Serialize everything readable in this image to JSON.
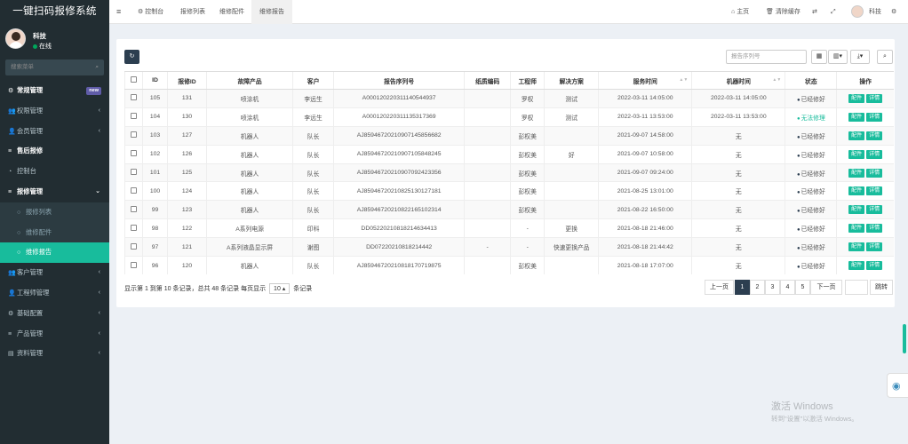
{
  "app_title": "一键扫码报修系统",
  "user": {
    "name": "科技",
    "status": "在线"
  },
  "search_placeholder": "搜索菜单",
  "menu": [
    {
      "label": "常规管理",
      "icon": "gear-icon",
      "badge": "new",
      "type": "head"
    },
    {
      "label": "权限管理",
      "icon": "users-icon",
      "type": "item"
    },
    {
      "label": "会员管理",
      "icon": "user-icon",
      "type": "item"
    },
    {
      "label": "售后报修",
      "icon": "list-icon",
      "type": "head"
    },
    {
      "label": "控制台",
      "icon": "dashboard-icon",
      "type": "item"
    },
    {
      "label": "报修管理",
      "icon": "list-icon",
      "type": "head-open"
    },
    {
      "label": "报修列表",
      "icon": "circle-icon",
      "type": "sub"
    },
    {
      "label": "维修配件",
      "icon": "circle-icon",
      "type": "sub"
    },
    {
      "label": "维修报告",
      "icon": "circle-icon",
      "type": "active"
    },
    {
      "label": "客户管理",
      "icon": "users-icon",
      "type": "item"
    },
    {
      "label": "工程师管理",
      "icon": "user-icon",
      "type": "item"
    },
    {
      "label": "基础配置",
      "icon": "gear-icon",
      "type": "item"
    },
    {
      "label": "产品管理",
      "icon": "list-icon",
      "type": "item"
    },
    {
      "label": "资料管理",
      "icon": "file-icon",
      "type": "item"
    }
  ],
  "topbar": {
    "tabs": [
      "控制台",
      "报修列表",
      "维修配件",
      "维修报告"
    ],
    "home": "主页",
    "clear_cache": "清除缓存",
    "user": "科技"
  },
  "toolbar": {
    "search_placeholder": "报告序列号"
  },
  "table": {
    "headers": [
      "ID",
      "报修ID",
      "故障产品",
      "客户",
      "报告序列号",
      "纸质编码",
      "工程师",
      "解决方案",
      "服务时间",
      "机器时间",
      "状态",
      "操作"
    ],
    "rows": [
      {
        "id": "105",
        "rid": "131",
        "product": "喷涂机",
        "customer": "李远生",
        "serial": "A00012022031114054493​7",
        "paper": "",
        "engineer": "罗权",
        "solution": "测试",
        "service_time": "2022-03-11 14:05:00",
        "machine_time": "2022-03-11 14:05:00",
        "status": "已经修好",
        "ok": true
      },
      {
        "id": "104",
        "rid": "130",
        "product": "喷涂机",
        "customer": "李远生",
        "serial": "A000120220311135317369",
        "paper": "",
        "engineer": "罗权",
        "solution": "测试",
        "service_time": "2022-03-11 13:53:00",
        "machine_time": "2022-03-11 13:53:00",
        "status": "无法修理",
        "ok": false
      },
      {
        "id": "103",
        "rid": "127",
        "product": "机器人",
        "customer": "队长",
        "serial": "AJ85946720210907145856682",
        "paper": "",
        "engineer": "彭权美",
        "solution": "",
        "service_time": "2021-09-07 14:58:00",
        "machine_time": "无",
        "status": "已经修好",
        "ok": true
      },
      {
        "id": "102",
        "rid": "126",
        "product": "机器人",
        "customer": "队长",
        "serial": "AJ85946720210907105848245",
        "paper": "",
        "engineer": "彭权美",
        "solution": "好",
        "service_time": "2021-09-07 10:58:00",
        "machine_time": "无",
        "status": "已经修好",
        "ok": true
      },
      {
        "id": "101",
        "rid": "125",
        "product": "机器人",
        "customer": "队长",
        "serial": "AJ85946720210907092423356",
        "paper": "",
        "engineer": "彭权美",
        "solution": "",
        "service_time": "2021-09-07 09:24:00",
        "machine_time": "无",
        "status": "已经修好",
        "ok": true
      },
      {
        "id": "100",
        "rid": "124",
        "product": "机器人",
        "customer": "队长",
        "serial": "AJ85946720210825130127181",
        "paper": "",
        "engineer": "彭权美",
        "solution": "",
        "service_time": "2021-08-25 13:01:00",
        "machine_time": "无",
        "status": "已经修好",
        "ok": true
      },
      {
        "id": "99",
        "rid": "123",
        "product": "机器人",
        "customer": "队长",
        "serial": "AJ85946720210822165102314",
        "paper": "",
        "engineer": "彭权美",
        "solution": "",
        "service_time": "2021-08-22 16:50:00",
        "machine_time": "无",
        "status": "已经修好",
        "ok": true
      },
      {
        "id": "98",
        "rid": "122",
        "product": "A系列电源",
        "customer": "印科",
        "serial": "DD05220210818214634413",
        "paper": "",
        "engineer": "-",
        "solution": "更换",
        "service_time": "2021-08-18 21:46:00",
        "machine_time": "无",
        "status": "已经修好",
        "ok": true
      },
      {
        "id": "97",
        "rid": "121",
        "product": "A系列液晶显示屏",
        "customer": "谢图",
        "serial": "DD07220210818214442",
        "paper": "-",
        "engineer": "-",
        "solution": "快速更换产品",
        "service_time": "2021-08-18 21:44:42",
        "machine_time": "无",
        "status": "已经修好",
        "ok": true
      },
      {
        "id": "96",
        "rid": "120",
        "product": "机器人",
        "customer": "队长",
        "serial": "AJ85946720210818170719875",
        "paper": "",
        "engineer": "彭权美",
        "solution": "",
        "service_time": "2021-08-18 17:07:00",
        "machine_time": "无",
        "status": "已经修好",
        "ok": true
      }
    ],
    "op_parts": "配件",
    "op_detail": "详情"
  },
  "pager": {
    "info_prefix": "显示第 1 到第 10 条记录，总共 48 条记录 每页显示",
    "page_size": "10",
    "info_suffix": "条记录",
    "prev": "上一页",
    "pages": [
      "1",
      "2",
      "3",
      "4",
      "5"
    ],
    "next": "下一页",
    "jump": "跳转"
  },
  "watermark": {
    "line1": "激活 Windows",
    "line2": "转到\"设置\"以激活 Windows。"
  }
}
